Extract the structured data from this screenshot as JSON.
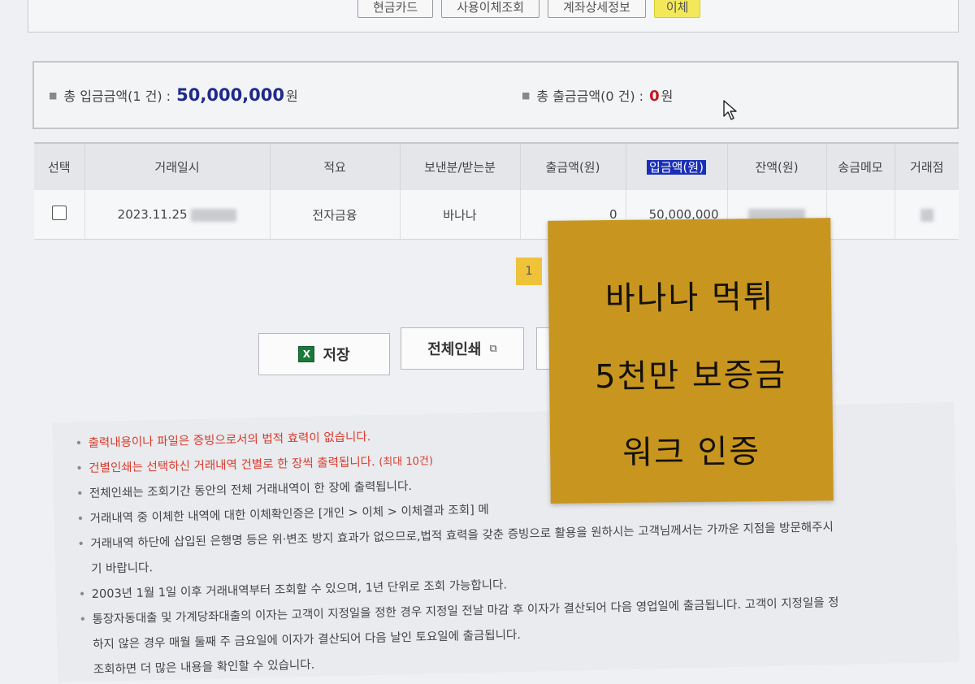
{
  "top_tabs": [
    "현금카드",
    "사용이체조회",
    "계좌상세정보",
    "이체"
  ],
  "summary": {
    "deposit_label": "총 입금금액(1 건) :",
    "deposit_value": "50,000,000",
    "deposit_unit": "원",
    "withdraw_label": "총 출금금액(0 건) :",
    "withdraw_value": "0",
    "withdraw_unit": "원"
  },
  "table": {
    "headers": [
      "선택",
      "거래일시",
      "적요",
      "보낸분/받는분",
      "출금액(원)",
      "입금액(원)",
      "잔액(원)",
      "송금메모",
      "거래점"
    ],
    "rows": [
      {
        "date": "2023.11.25",
        "summary": "전자금융",
        "counterparty": "바나나",
        "withdraw": "0",
        "deposit": "50,000,000"
      }
    ]
  },
  "pagination": {
    "current": "1"
  },
  "buttons": {
    "save": "저장",
    "print_all": "전체인쇄"
  },
  "notices": [
    "출력내용이나 파일은 증빙으로서의 법적 효력이 없습니다.",
    "건별인쇄는 선택하신 거래내역 건별로 한 장씩 출력됩니다.",
    "(최대 10건)",
    "전체인쇄는 조회기간 동안의 전체 거래내역이 한 장에 출력됩니다.",
    "거래내역 중 이체한 내역에 대한 이체확인증은 [개인 > 이체 > 이체결과 조회] 메",
    "거래내역 하단에 삽입된 은행명 등은 위·변조 방지 효과가 없으므로,법적 효력을 갖춘 증빙으로 활용을 원하시는 고객님께서는 가까운 지점을 방문해주시",
    "기 바랍니다.",
    "2003년 1월 1일 이후 거래내역부터 조회할 수 있으며, 1년 단위로 조회 가능합니다.",
    "통장자동대출 및 가계당좌대출의 이자는 고객이 지정일을 정한 경우 지정일 전날 마감 후 이자가 결산되어 다음 영업일에 출금됩니다. 고객이 지정일을 정",
    "하지 않은 경우 매월 둘째 주 금요일에 이자가 결산되어 다음 날인 토요일에 출금됩니다.",
    "조회하면 더 많은 내용을 확인할 수 있습니다."
  ],
  "sticky_note": [
    "바나나 먹튀",
    "5천만 보증금",
    "워크 인증"
  ]
}
